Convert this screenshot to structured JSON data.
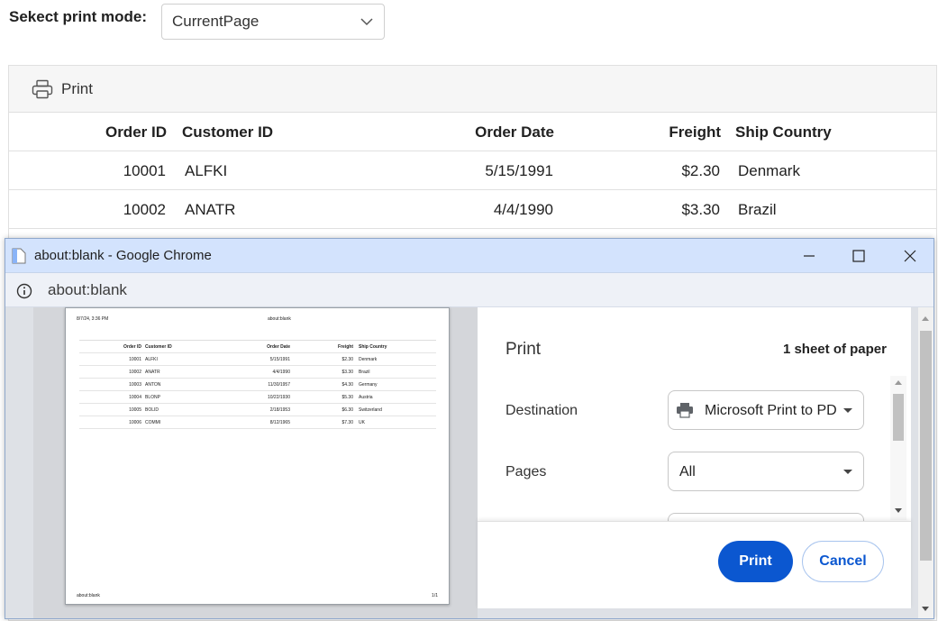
{
  "print_mode": {
    "label": "Sekect print mode:",
    "selected": "CurrentPage"
  },
  "grid": {
    "toolbar": {
      "print_label": "Print",
      "icon": "printer-icon"
    },
    "columns": [
      "Order ID",
      "Customer ID",
      "Order Date",
      "Freight",
      "Ship Country"
    ],
    "rows": [
      [
        "10001",
        "ALFKI",
        "5/15/1991",
        "$2.30",
        "Denmark"
      ],
      [
        "10002",
        "ANATR",
        "4/4/1990",
        "$3.30",
        "Brazil"
      ]
    ]
  },
  "chrome": {
    "window_title": "about:blank - Google Chrome",
    "url": "about:blank",
    "preview": {
      "header_left": "8/7/24, 3:36 PM",
      "header_center": "about:blank",
      "footer_left": "about:blank",
      "footer_right": "1/1",
      "columns": [
        "Order ID",
        "Customer ID",
        "Order Date",
        "Freight",
        "Ship Country"
      ],
      "rows": [
        [
          "10001",
          "ALFKI",
          "5/15/1991",
          "$2.30",
          "Denmark"
        ],
        [
          "10002",
          "ANATR",
          "4/4/1990",
          "$3.30",
          "Brazil"
        ],
        [
          "10003",
          "ANTON",
          "11/30/1957",
          "$4.30",
          "Germany"
        ],
        [
          "10004",
          "BLONP",
          "10/22/1930",
          "$5.30",
          "Austria"
        ],
        [
          "10005",
          "BOLID",
          "2/18/1953",
          "$6.30",
          "Switzerland"
        ],
        [
          "10006",
          "COMMI",
          "8/12/1965",
          "$7.30",
          "UK"
        ]
      ]
    },
    "print_dialog": {
      "title": "Print",
      "sheets": "1 sheet of paper",
      "destination_label": "Destination",
      "destination_value": "Microsoft Print to PD",
      "pages_label": "Pages",
      "pages_value": "All",
      "print_button": "Print",
      "cancel_button": "Cancel"
    }
  },
  "colors": {
    "accent": "#0b57d0",
    "titlebar": "#d3e3fd",
    "toolbar_bg": "#f6f6f6"
  }
}
